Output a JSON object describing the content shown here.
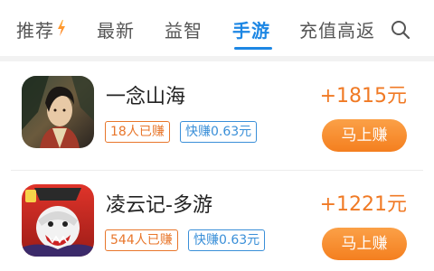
{
  "tabs": [
    {
      "label": "推荐",
      "active": false,
      "has_flame": true
    },
    {
      "label": "最新",
      "active": false
    },
    {
      "label": "益智",
      "active": false
    },
    {
      "label": "手游",
      "active": true
    },
    {
      "label": "充值高返",
      "active": false
    }
  ],
  "search_icon": "search-icon",
  "games": [
    {
      "name": "一念山海",
      "reward": "+1815元",
      "count_tag": "18人已赚",
      "quick_tag": "快赚0.63元",
      "button": "马上赚"
    },
    {
      "name": "凌云记-多游",
      "reward": "+1221元",
      "count_tag": "544人已赚",
      "quick_tag": "快赚0.63元",
      "button": "马上赚"
    }
  ],
  "colors": {
    "accent": "#1d87e4",
    "reward": "#f07a25",
    "button": "#f58a2a",
    "quick_tag": "#3a8fd8"
  }
}
